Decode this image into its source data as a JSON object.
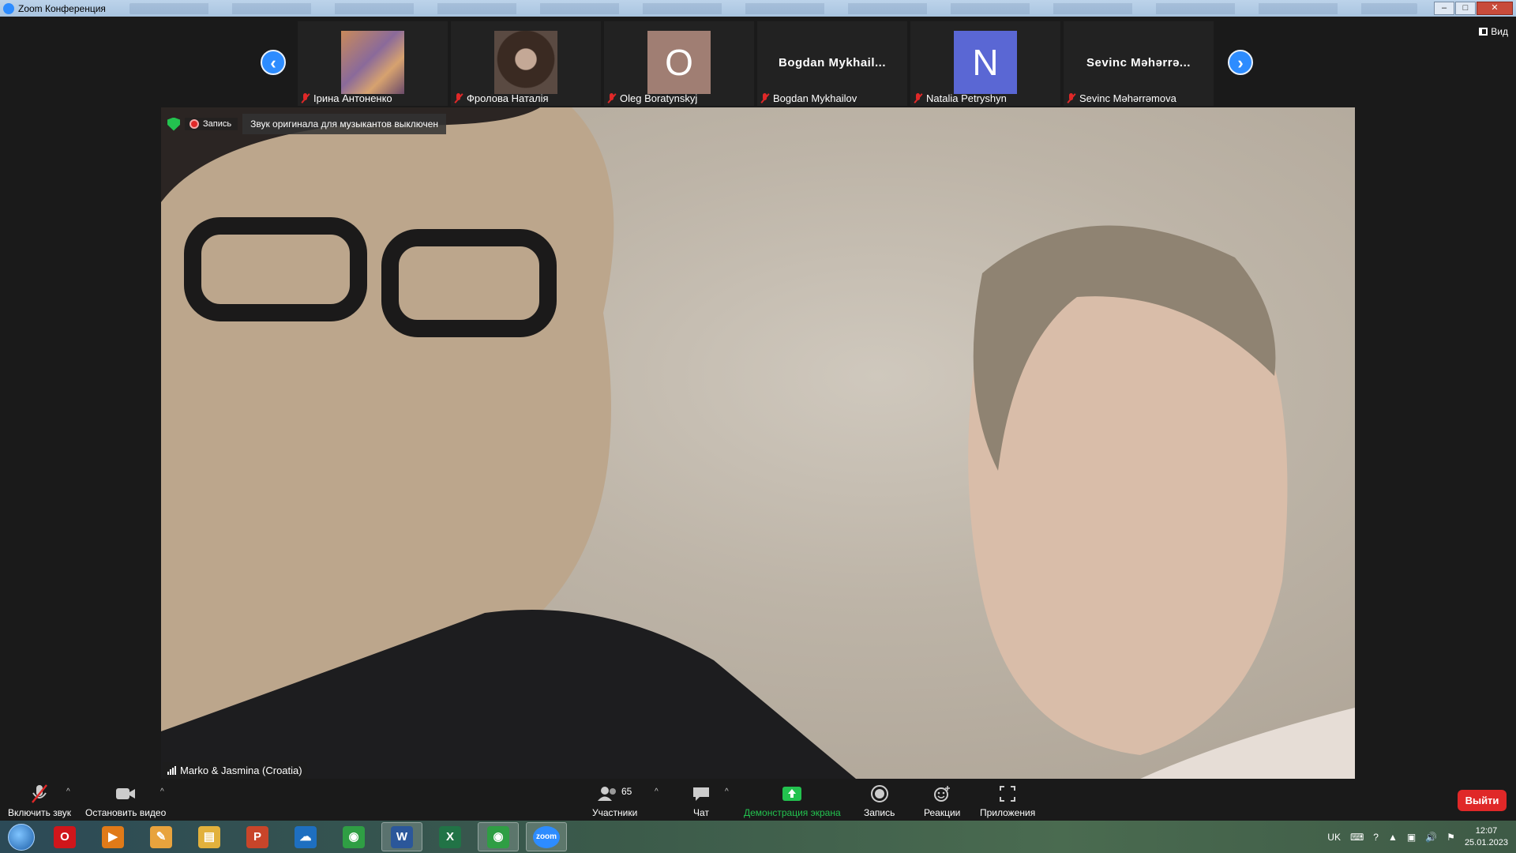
{
  "window": {
    "title": "Zoom Конференция",
    "buttons": [
      "–",
      "□",
      "✕"
    ]
  },
  "view_button": {
    "label": "Вид"
  },
  "participants_strip": [
    {
      "name": "Ірина Антоненко",
      "kind": "photo",
      "photo_colors": [
        "#c98a5a",
        "#7a5a8a"
      ]
    },
    {
      "name": "Фролова Наталія",
      "kind": "photo",
      "photo_colors": [
        "#3a2a22",
        "#b59a86"
      ]
    },
    {
      "name": "Oleg Boratynskyj",
      "kind": "initial",
      "initial": "O",
      "color": "#a07e73"
    },
    {
      "name": "Bogdan Mykhailov",
      "kind": "text",
      "display": "Bogdan  Mykhail..."
    },
    {
      "name": "Natalia Petryshyn",
      "kind": "initial",
      "initial": "N",
      "color": "#5a67d4"
    },
    {
      "name": "Sevinc Məhərrəmova",
      "kind": "text",
      "display": "Sevinc  Məhərrə..."
    }
  ],
  "main_video": {
    "recording_label": "Запись",
    "banner": "Звук оригинала для музыкантов выключен",
    "speaker": "Marko & Jasmina (Croatia)"
  },
  "toolbar": {
    "unmute": "Включить звук",
    "stop_video": "Остановить видео",
    "participants": "Участники",
    "participants_count": "65",
    "chat": "Чат",
    "share": "Демонстрация экрана",
    "record": "Запись",
    "reactions": "Реакции",
    "apps": "Приложения",
    "leave": "Выйти",
    "accent": "#23c24f"
  },
  "taskbar": {
    "apps": [
      {
        "name": "opera-icon",
        "glyph": "O",
        "color": "#d0161b"
      },
      {
        "name": "media-player-icon",
        "glyph": "▶",
        "color": "#e07a18"
      },
      {
        "name": "paint-icon",
        "glyph": "✎",
        "color": "#e8a33d"
      },
      {
        "name": "explorer-icon",
        "glyph": "▤",
        "color": "#e2b13c"
      },
      {
        "name": "powerpoint-icon",
        "glyph": "P",
        "color": "#c8452a"
      },
      {
        "name": "onedrive-icon",
        "glyph": "☁",
        "color": "#1e6fc0"
      },
      {
        "name": "chrome-icon",
        "glyph": "◉",
        "color": "#2f9e44"
      },
      {
        "name": "word-icon",
        "glyph": "W",
        "color": "#2b579a"
      },
      {
        "name": "excel-icon",
        "glyph": "X",
        "color": "#217346"
      },
      {
        "name": "chrome-icon",
        "glyph": "◉",
        "color": "#2f9e44"
      },
      {
        "name": "zoom-icon",
        "glyph": "zoom",
        "color": "#2d8cff"
      }
    ],
    "lang": "UK",
    "time": "12:07",
    "date": "25.01.2023"
  }
}
